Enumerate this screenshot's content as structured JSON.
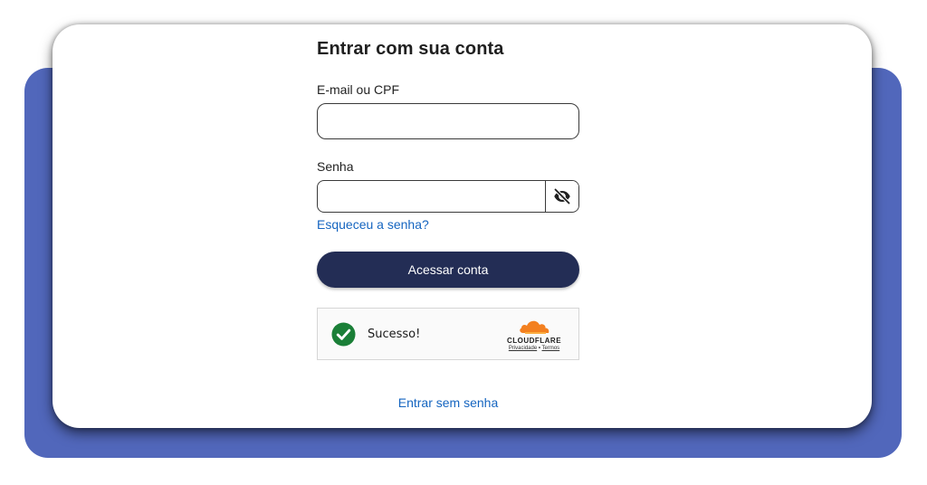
{
  "login": {
    "title": "Entrar com sua conta",
    "email_label": "E-mail ou CPF",
    "email_value": "",
    "password_label": "Senha",
    "password_value": "",
    "toggle_visibility_icon": "eye-slash-icon",
    "forgot_link": "Esqueceu a senha?",
    "submit_label": "Acessar conta",
    "passwordless_link": "Entrar sem senha"
  },
  "captcha": {
    "status_text": "Sucesso!",
    "status_icon": "check-circle-icon",
    "brand": "CLOUDFLARE",
    "privacy_link": "Privacidade",
    "separator": "•",
    "terms_link": "Termos"
  },
  "colors": {
    "background_accent": "#5167bb",
    "button_primary": "#232d55",
    "link": "#1565c0",
    "success": "#1a7f37",
    "cloudflare_orange": "#f38020"
  }
}
